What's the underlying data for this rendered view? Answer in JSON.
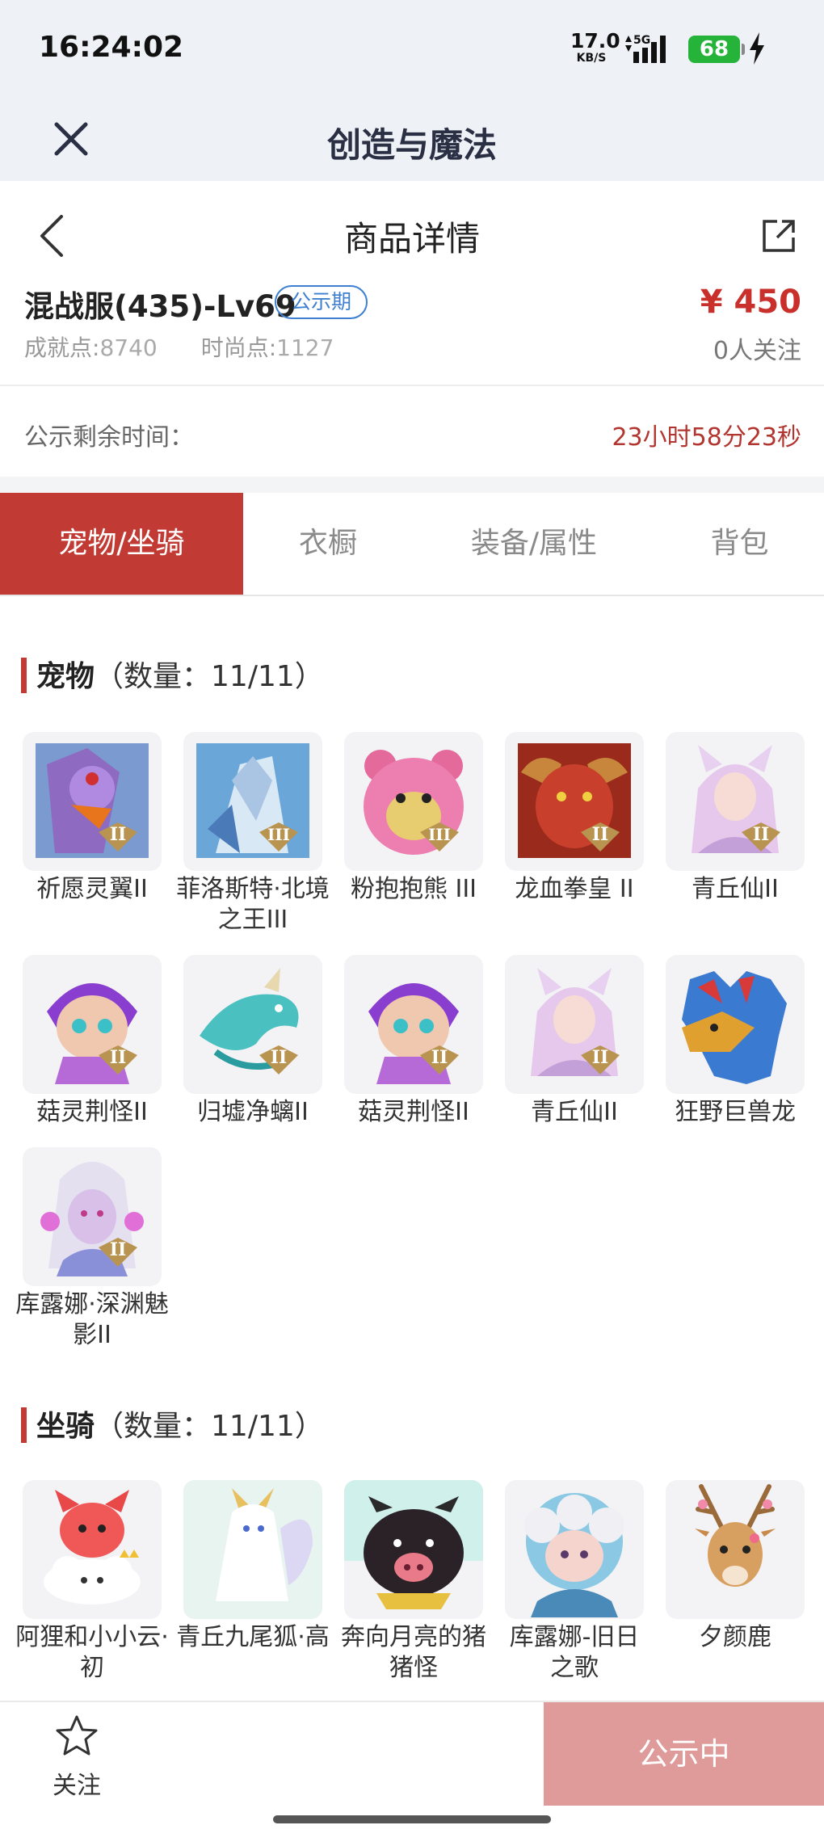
{
  "status_bar": {
    "time": "16:24:02",
    "net_speed_value": "17.0",
    "net_speed_unit": "KB/S",
    "network": "5G",
    "battery": "68"
  },
  "app_bar": {
    "title": "创造与魔法"
  },
  "nav": {
    "title": "商品详情"
  },
  "product": {
    "name": "混战服(435)-Lv69",
    "badge": "公示期",
    "price": "¥ 450",
    "achievement_label": "成就点:",
    "achievement_value": "8740",
    "fashion_label": "时尚点:",
    "fashion_value": "1127",
    "followers": "0人关注"
  },
  "countdown": {
    "label": "公示剩余时间：",
    "value": "23小时58分23秒"
  },
  "tabs": [
    {
      "label": "宠物/坐骑"
    },
    {
      "label": "衣橱"
    },
    {
      "label": "装备/属性"
    },
    {
      "label": "背包"
    }
  ],
  "pets": {
    "title": "宠物",
    "count": "（数量：11/11）",
    "items": [
      {
        "name": "祈愿灵翼II"
      },
      {
        "name": "菲洛斯特·北境之王III"
      },
      {
        "name": "粉抱抱熊 III"
      },
      {
        "name": "龙血拳皇 II"
      },
      {
        "name": "青丘仙II"
      },
      {
        "name": "菇灵荆怪II"
      },
      {
        "name": "归墟净螭II"
      },
      {
        "name": "菇灵荆怪II"
      },
      {
        "name": "青丘仙II"
      },
      {
        "name": "狂野巨兽龙"
      },
      {
        "name": "库露娜·深渊魅影II"
      }
    ]
  },
  "mounts": {
    "title": "坐骑",
    "count": "（数量：11/11）",
    "items": [
      {
        "name": "阿狸和小小云·初"
      },
      {
        "name": "青丘九尾狐·高"
      },
      {
        "name": "奔向月亮的猪猪怪"
      },
      {
        "name": "库露娜-旧日之歌"
      },
      {
        "name": "夕颜鹿"
      }
    ]
  },
  "bottom_bar": {
    "follow_label": "关注",
    "status_label": "公示中"
  },
  "colors": {
    "accent": "#c23a34",
    "price": "#c9302c",
    "badge": "#3d7fd1",
    "status_button": "#df9a9a",
    "battery": "#25b33a"
  }
}
